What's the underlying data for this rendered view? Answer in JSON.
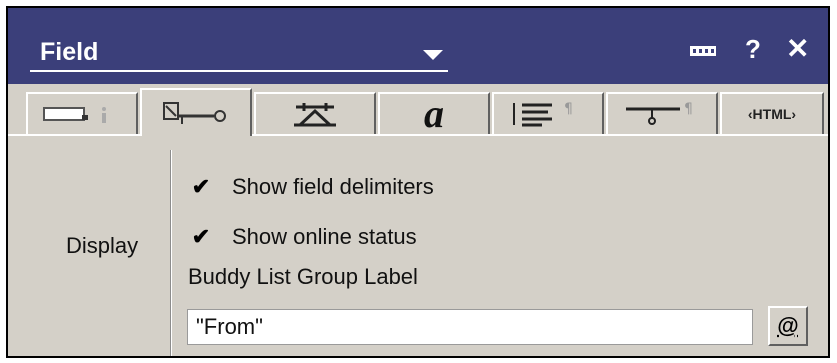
{
  "titlebar": {
    "title": "Field",
    "help_glyph": "?",
    "close_glyph": "✕"
  },
  "tabs": [
    {
      "icon": "field-info-icon"
    },
    {
      "icon": "field-options-icon",
      "active": true
    },
    {
      "icon": "font-icon"
    },
    {
      "label": "a",
      "icon": "font-style-icon"
    },
    {
      "icon": "paragraph-icon"
    },
    {
      "icon": "paragraph-hide-icon"
    },
    {
      "label": "‹HTML›",
      "icon": "html-icon"
    }
  ],
  "content": {
    "display_label": "Display",
    "show_field_delimiters": {
      "label": "Show field delimiters",
      "checked": true
    },
    "show_online_status": {
      "label": "Show online status",
      "checked": true
    },
    "group_label": "Buddy List Group Label",
    "group_value": "\"From\"",
    "at_button": "@",
    "check_glyph": "✔"
  },
  "colors": {
    "titlebar": "#3b3f7a",
    "panel": "#d4d0c8",
    "border": "#000000"
  }
}
